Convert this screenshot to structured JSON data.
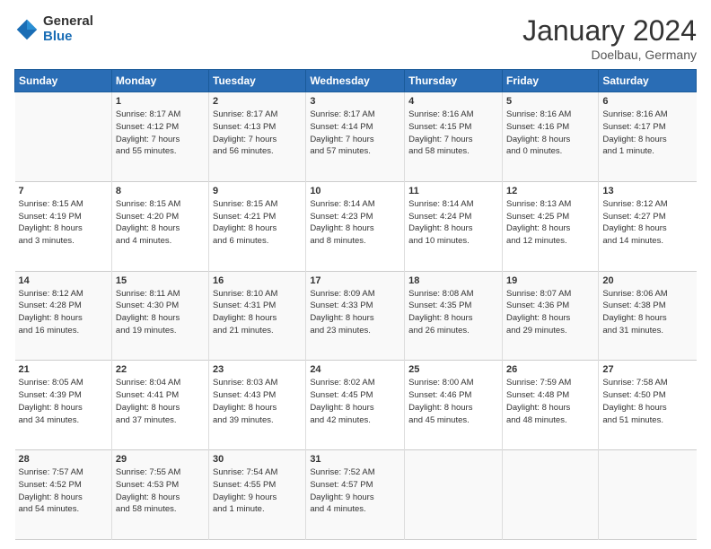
{
  "logo": {
    "general": "General",
    "blue": "Blue"
  },
  "title": "January 2024",
  "subtitle": "Doelbau, Germany",
  "headers": [
    "Sunday",
    "Monday",
    "Tuesday",
    "Wednesday",
    "Thursday",
    "Friday",
    "Saturday"
  ],
  "weeks": [
    [
      {
        "num": "",
        "info": ""
      },
      {
        "num": "1",
        "info": "Sunrise: 8:17 AM\nSunset: 4:12 PM\nDaylight: 7 hours\nand 55 minutes."
      },
      {
        "num": "2",
        "info": "Sunrise: 8:17 AM\nSunset: 4:13 PM\nDaylight: 7 hours\nand 56 minutes."
      },
      {
        "num": "3",
        "info": "Sunrise: 8:17 AM\nSunset: 4:14 PM\nDaylight: 7 hours\nand 57 minutes."
      },
      {
        "num": "4",
        "info": "Sunrise: 8:16 AM\nSunset: 4:15 PM\nDaylight: 7 hours\nand 58 minutes."
      },
      {
        "num": "5",
        "info": "Sunrise: 8:16 AM\nSunset: 4:16 PM\nDaylight: 8 hours\nand 0 minutes."
      },
      {
        "num": "6",
        "info": "Sunrise: 8:16 AM\nSunset: 4:17 PM\nDaylight: 8 hours\nand 1 minute."
      }
    ],
    [
      {
        "num": "7",
        "info": "Sunrise: 8:15 AM\nSunset: 4:19 PM\nDaylight: 8 hours\nand 3 minutes."
      },
      {
        "num": "8",
        "info": "Sunrise: 8:15 AM\nSunset: 4:20 PM\nDaylight: 8 hours\nand 4 minutes."
      },
      {
        "num": "9",
        "info": "Sunrise: 8:15 AM\nSunset: 4:21 PM\nDaylight: 8 hours\nand 6 minutes."
      },
      {
        "num": "10",
        "info": "Sunrise: 8:14 AM\nSunset: 4:23 PM\nDaylight: 8 hours\nand 8 minutes."
      },
      {
        "num": "11",
        "info": "Sunrise: 8:14 AM\nSunset: 4:24 PM\nDaylight: 8 hours\nand 10 minutes."
      },
      {
        "num": "12",
        "info": "Sunrise: 8:13 AM\nSunset: 4:25 PM\nDaylight: 8 hours\nand 12 minutes."
      },
      {
        "num": "13",
        "info": "Sunrise: 8:12 AM\nSunset: 4:27 PM\nDaylight: 8 hours\nand 14 minutes."
      }
    ],
    [
      {
        "num": "14",
        "info": "Sunrise: 8:12 AM\nSunset: 4:28 PM\nDaylight: 8 hours\nand 16 minutes."
      },
      {
        "num": "15",
        "info": "Sunrise: 8:11 AM\nSunset: 4:30 PM\nDaylight: 8 hours\nand 19 minutes."
      },
      {
        "num": "16",
        "info": "Sunrise: 8:10 AM\nSunset: 4:31 PM\nDaylight: 8 hours\nand 21 minutes."
      },
      {
        "num": "17",
        "info": "Sunrise: 8:09 AM\nSunset: 4:33 PM\nDaylight: 8 hours\nand 23 minutes."
      },
      {
        "num": "18",
        "info": "Sunrise: 8:08 AM\nSunset: 4:35 PM\nDaylight: 8 hours\nand 26 minutes."
      },
      {
        "num": "19",
        "info": "Sunrise: 8:07 AM\nSunset: 4:36 PM\nDaylight: 8 hours\nand 29 minutes."
      },
      {
        "num": "20",
        "info": "Sunrise: 8:06 AM\nSunset: 4:38 PM\nDaylight: 8 hours\nand 31 minutes."
      }
    ],
    [
      {
        "num": "21",
        "info": "Sunrise: 8:05 AM\nSunset: 4:39 PM\nDaylight: 8 hours\nand 34 minutes."
      },
      {
        "num": "22",
        "info": "Sunrise: 8:04 AM\nSunset: 4:41 PM\nDaylight: 8 hours\nand 37 minutes."
      },
      {
        "num": "23",
        "info": "Sunrise: 8:03 AM\nSunset: 4:43 PM\nDaylight: 8 hours\nand 39 minutes."
      },
      {
        "num": "24",
        "info": "Sunrise: 8:02 AM\nSunset: 4:45 PM\nDaylight: 8 hours\nand 42 minutes."
      },
      {
        "num": "25",
        "info": "Sunrise: 8:00 AM\nSunset: 4:46 PM\nDaylight: 8 hours\nand 45 minutes."
      },
      {
        "num": "26",
        "info": "Sunrise: 7:59 AM\nSunset: 4:48 PM\nDaylight: 8 hours\nand 48 minutes."
      },
      {
        "num": "27",
        "info": "Sunrise: 7:58 AM\nSunset: 4:50 PM\nDaylight: 8 hours\nand 51 minutes."
      }
    ],
    [
      {
        "num": "28",
        "info": "Sunrise: 7:57 AM\nSunset: 4:52 PM\nDaylight: 8 hours\nand 54 minutes."
      },
      {
        "num": "29",
        "info": "Sunrise: 7:55 AM\nSunset: 4:53 PM\nDaylight: 8 hours\nand 58 minutes."
      },
      {
        "num": "30",
        "info": "Sunrise: 7:54 AM\nSunset: 4:55 PM\nDaylight: 9 hours\nand 1 minute."
      },
      {
        "num": "31",
        "info": "Sunrise: 7:52 AM\nSunset: 4:57 PM\nDaylight: 9 hours\nand 4 minutes."
      },
      {
        "num": "",
        "info": ""
      },
      {
        "num": "",
        "info": ""
      },
      {
        "num": "",
        "info": ""
      }
    ]
  ]
}
